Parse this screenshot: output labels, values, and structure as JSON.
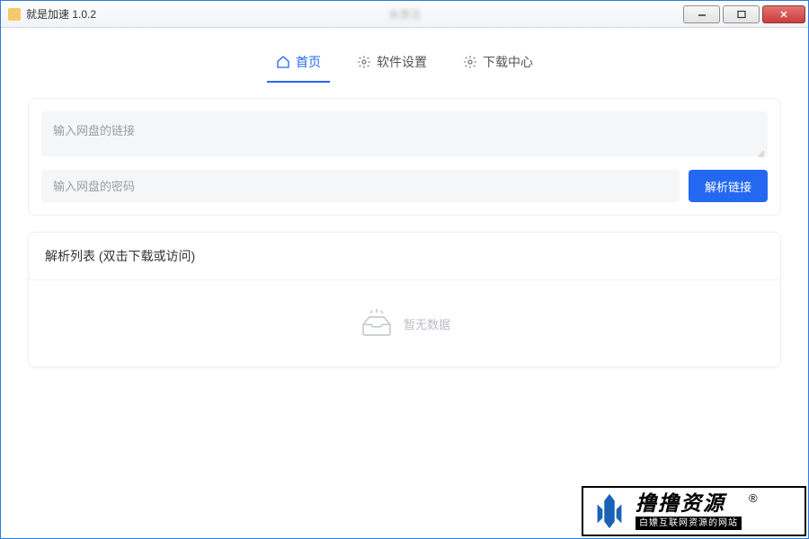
{
  "window": {
    "title": "就是加速  1.0.2",
    "blurred_center": "未激活"
  },
  "tabs": [
    {
      "label": "首页",
      "icon": "home-icon",
      "active": true
    },
    {
      "label": "软件设置",
      "icon": "gear-icon",
      "active": false
    },
    {
      "label": "下载中心",
      "icon": "gear-icon",
      "active": false
    }
  ],
  "inputs": {
    "link_placeholder": "输入网盘的链接",
    "password_placeholder": "输入网盘的密码"
  },
  "buttons": {
    "parse": "解析链接"
  },
  "result": {
    "header": "解析列表 (双击下载或访问)",
    "empty_text": "暂无数据"
  },
  "watermark": {
    "big": "撸撸资源",
    "sub": "白嫖互联网资源的网站",
    "registered": "®"
  }
}
